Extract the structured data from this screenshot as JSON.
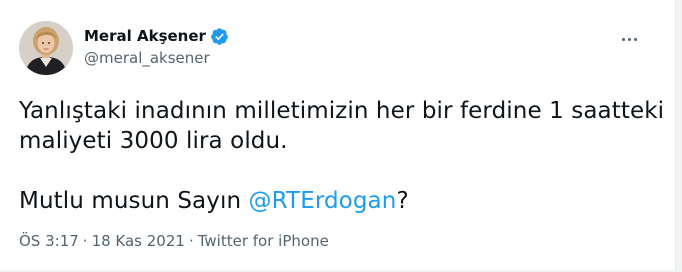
{
  "user": {
    "display_name": "Meral Akşener",
    "handle": "@meral_aksener",
    "verified": true
  },
  "icons": {
    "verified": "verified-badge-icon",
    "more": "more-options-icon",
    "avatar": "avatar-image"
  },
  "colors": {
    "text": "#0f1419",
    "secondary": "#536471",
    "accent": "#1d9bf0"
  },
  "tweet": {
    "line1": "Yanlıştaki inadının milletimizin her bir ferdine 1 saatteki",
    "line2": "maliyeti 3000 lira oldu.",
    "line3_prefix": "Mutlu musun Sayın ",
    "line3_mention": "@RTErdogan",
    "line3_suffix": "?"
  },
  "meta": {
    "time": "ÖS 3:17",
    "separator": "·",
    "date": "18 Kas 2021",
    "source": "Twitter for iPhone"
  }
}
